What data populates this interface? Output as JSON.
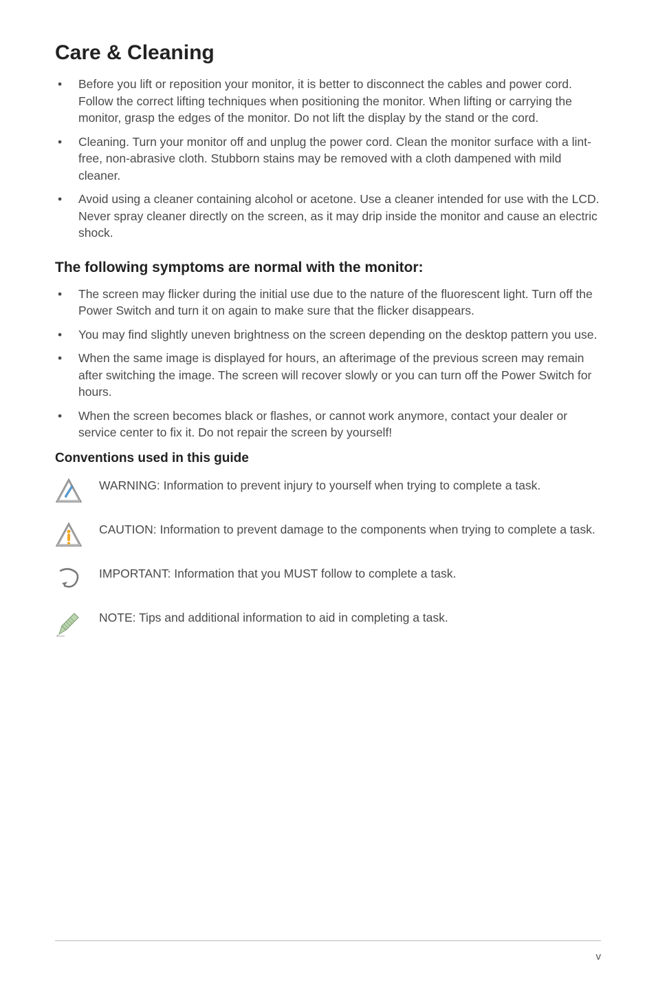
{
  "title": "Care & Cleaning",
  "bullets_main": [
    "Before you lift or reposition your monitor, it is better to disconnect the cables and power cord. Follow the correct lifting techniques when positioning the monitor. When lifting or carrying the monitor, grasp the edges of the monitor. Do not lift the display by the stand or the cord.",
    "Cleaning. Turn your monitor off and unplug the power cord. Clean the monitor surface with a lint-free, non-abrasive cloth. Stubborn stains may be removed with a cloth dampened with mild cleaner.",
    "Avoid using a cleaner containing alcohol or acetone. Use a cleaner intended for use with the LCD. Never spray cleaner directly on the screen, as it may drip inside the monitor and cause an electric shock."
  ],
  "symptoms_heading": "The following symptoms are normal with the monitor:",
  "bullets_symptoms": [
    "The screen may flicker during the initial use due to the nature of the fluorescent light. Turn off the Power Switch and turn it on again to make sure that the flicker disappears.",
    "You may find slightly uneven brightness on the screen depending on the desktop pattern you use.",
    "When the same image is displayed for hours, an afterimage of the previous screen may remain after switching the image. The screen will recover slowly or you can turn off the Power Switch for hours.",
    "When the screen becomes black or flashes, or cannot work anymore, contact your dealer or service center to fix it. Do not repair the screen by yourself!"
  ],
  "conventions_heading": "Conventions used in this guide",
  "conventions": {
    "warning": "WARNING: Information to prevent injury to yourself when trying to complete a task.",
    "caution": "CAUTION: Information to prevent damage to the components when trying to complete a task.",
    "important": "IMPORTANT: Information that you MUST follow to complete a task.",
    "note": "NOTE: Tips and additional information to aid in completing a task."
  },
  "page_number": "v"
}
